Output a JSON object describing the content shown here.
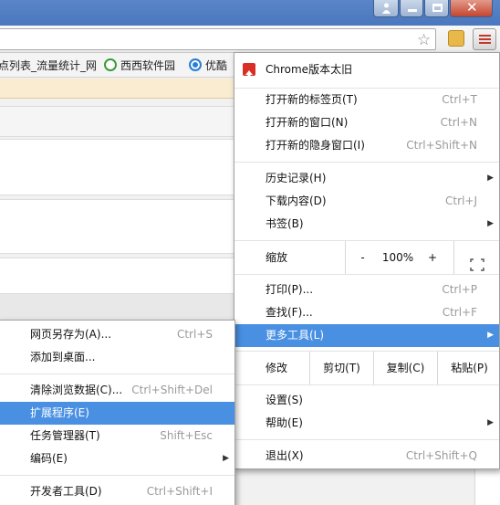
{
  "titlebar": {},
  "toolbar": {},
  "bookmarks": [
    {
      "label": "点列表_流量统计_网"
    },
    {
      "label": "西西软件园"
    },
    {
      "label": "优酷"
    }
  ],
  "main_menu": {
    "update": "Chrome版本太旧",
    "items": [
      {
        "label": "打开新的标签页(T)",
        "shortcut": "Ctrl+T"
      },
      {
        "label": "打开新的窗口(N)",
        "shortcut": "Ctrl+N"
      },
      {
        "label": "打开新的隐身窗口(I)",
        "shortcut": "Ctrl+Shift+N"
      },
      {
        "label": "历史记录(H)"
      },
      {
        "label": "下载内容(D)",
        "shortcut": "Ctrl+J"
      },
      {
        "label": "书签(B)"
      }
    ],
    "zoom": {
      "label": "缩放",
      "minus": "-",
      "value": "100%",
      "plus": "+"
    },
    "items2": [
      {
        "label": "打印(P)...",
        "shortcut": "Ctrl+P"
      },
      {
        "label": "查找(F)...",
        "shortcut": "Ctrl+F"
      },
      {
        "label": "更多工具(L)"
      }
    ],
    "edit": {
      "label": "修改",
      "cut": "剪切(T)",
      "copy": "复制(C)",
      "paste": "粘贴(P)"
    },
    "items3": [
      {
        "label": "设置(S)"
      },
      {
        "label": "帮助(E)"
      },
      {
        "label": "退出(X)",
        "shortcut": "Ctrl+Shift+Q"
      }
    ]
  },
  "sub_menu": {
    "items": [
      {
        "label": "网页另存为(A)...",
        "shortcut": "Ctrl+S"
      },
      {
        "label": "添加到桌面..."
      },
      {
        "label": "清除浏览数据(C)...",
        "shortcut": "Ctrl+Shift+Del"
      },
      {
        "label": "扩展程序(E)"
      },
      {
        "label": "任务管理器(T)",
        "shortcut": "Shift+Esc"
      },
      {
        "label": "编码(E)"
      },
      {
        "label": "开发者工具(D)",
        "shortcut": "Ctrl+Shift+I"
      }
    ]
  },
  "colors": {
    "highlight": "#4a90e2",
    "update_icon": "#d93025"
  }
}
